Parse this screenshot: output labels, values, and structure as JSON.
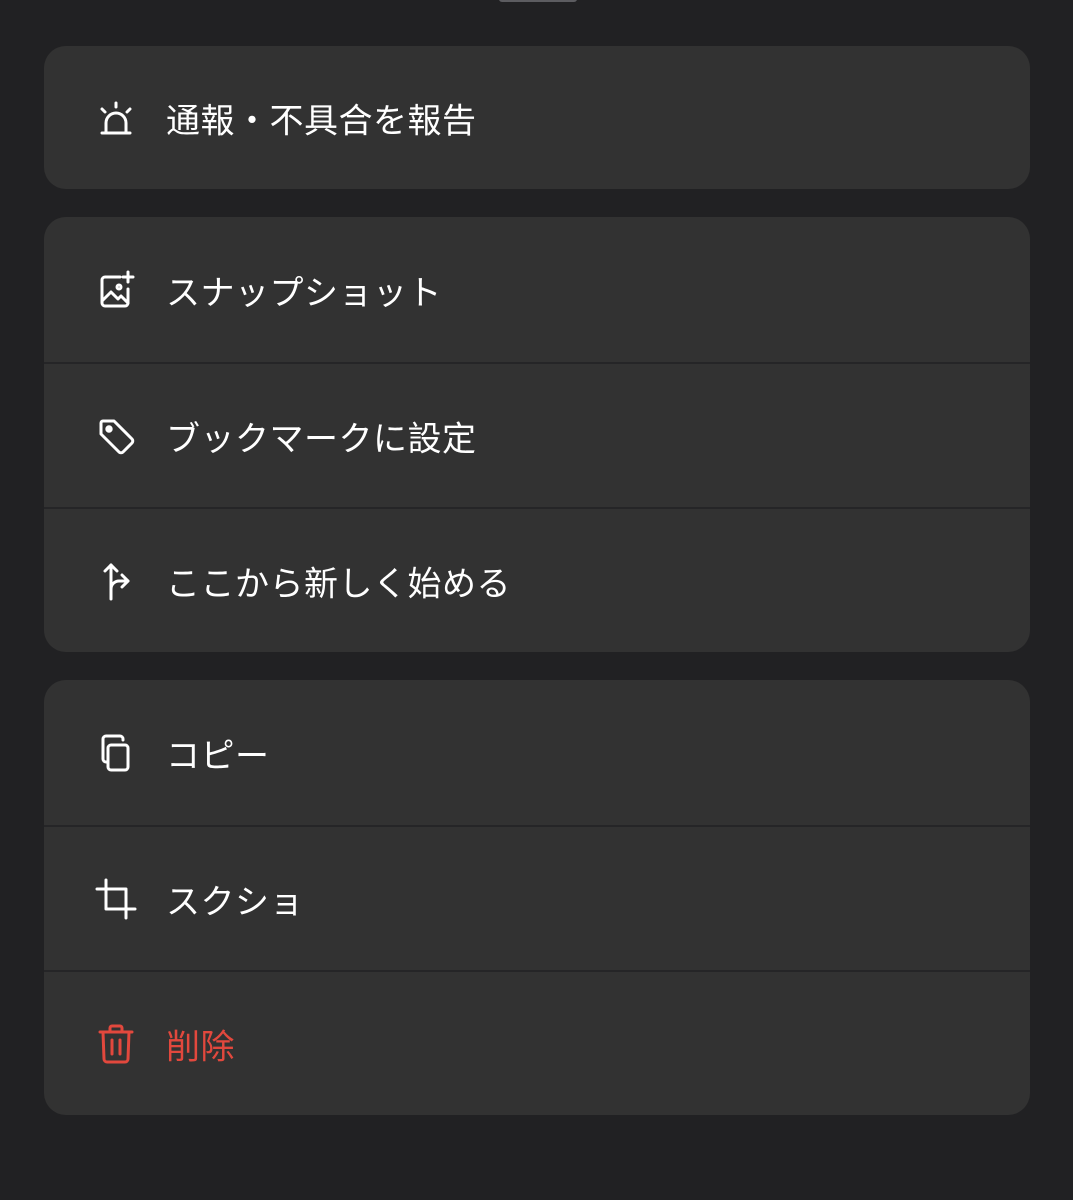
{
  "colors": {
    "background": "#212123",
    "card": "#323232",
    "text": "#ffffff",
    "danger": "#e2483d"
  },
  "groups": [
    {
      "items": [
        {
          "label": "通報・不具合を報告",
          "icon": "siren-icon"
        }
      ]
    },
    {
      "items": [
        {
          "label": "スナップショット",
          "icon": "image-plus-icon"
        },
        {
          "label": "ブックマークに設定",
          "icon": "tag-icon"
        },
        {
          "label": "ここから新しく始める",
          "icon": "branch-arrow-icon"
        }
      ]
    },
    {
      "items": [
        {
          "label": "コピー",
          "icon": "copy-icon"
        },
        {
          "label": "スクショ",
          "icon": "crop-icon"
        },
        {
          "label": "削除",
          "icon": "trash-icon"
        }
      ]
    }
  ]
}
